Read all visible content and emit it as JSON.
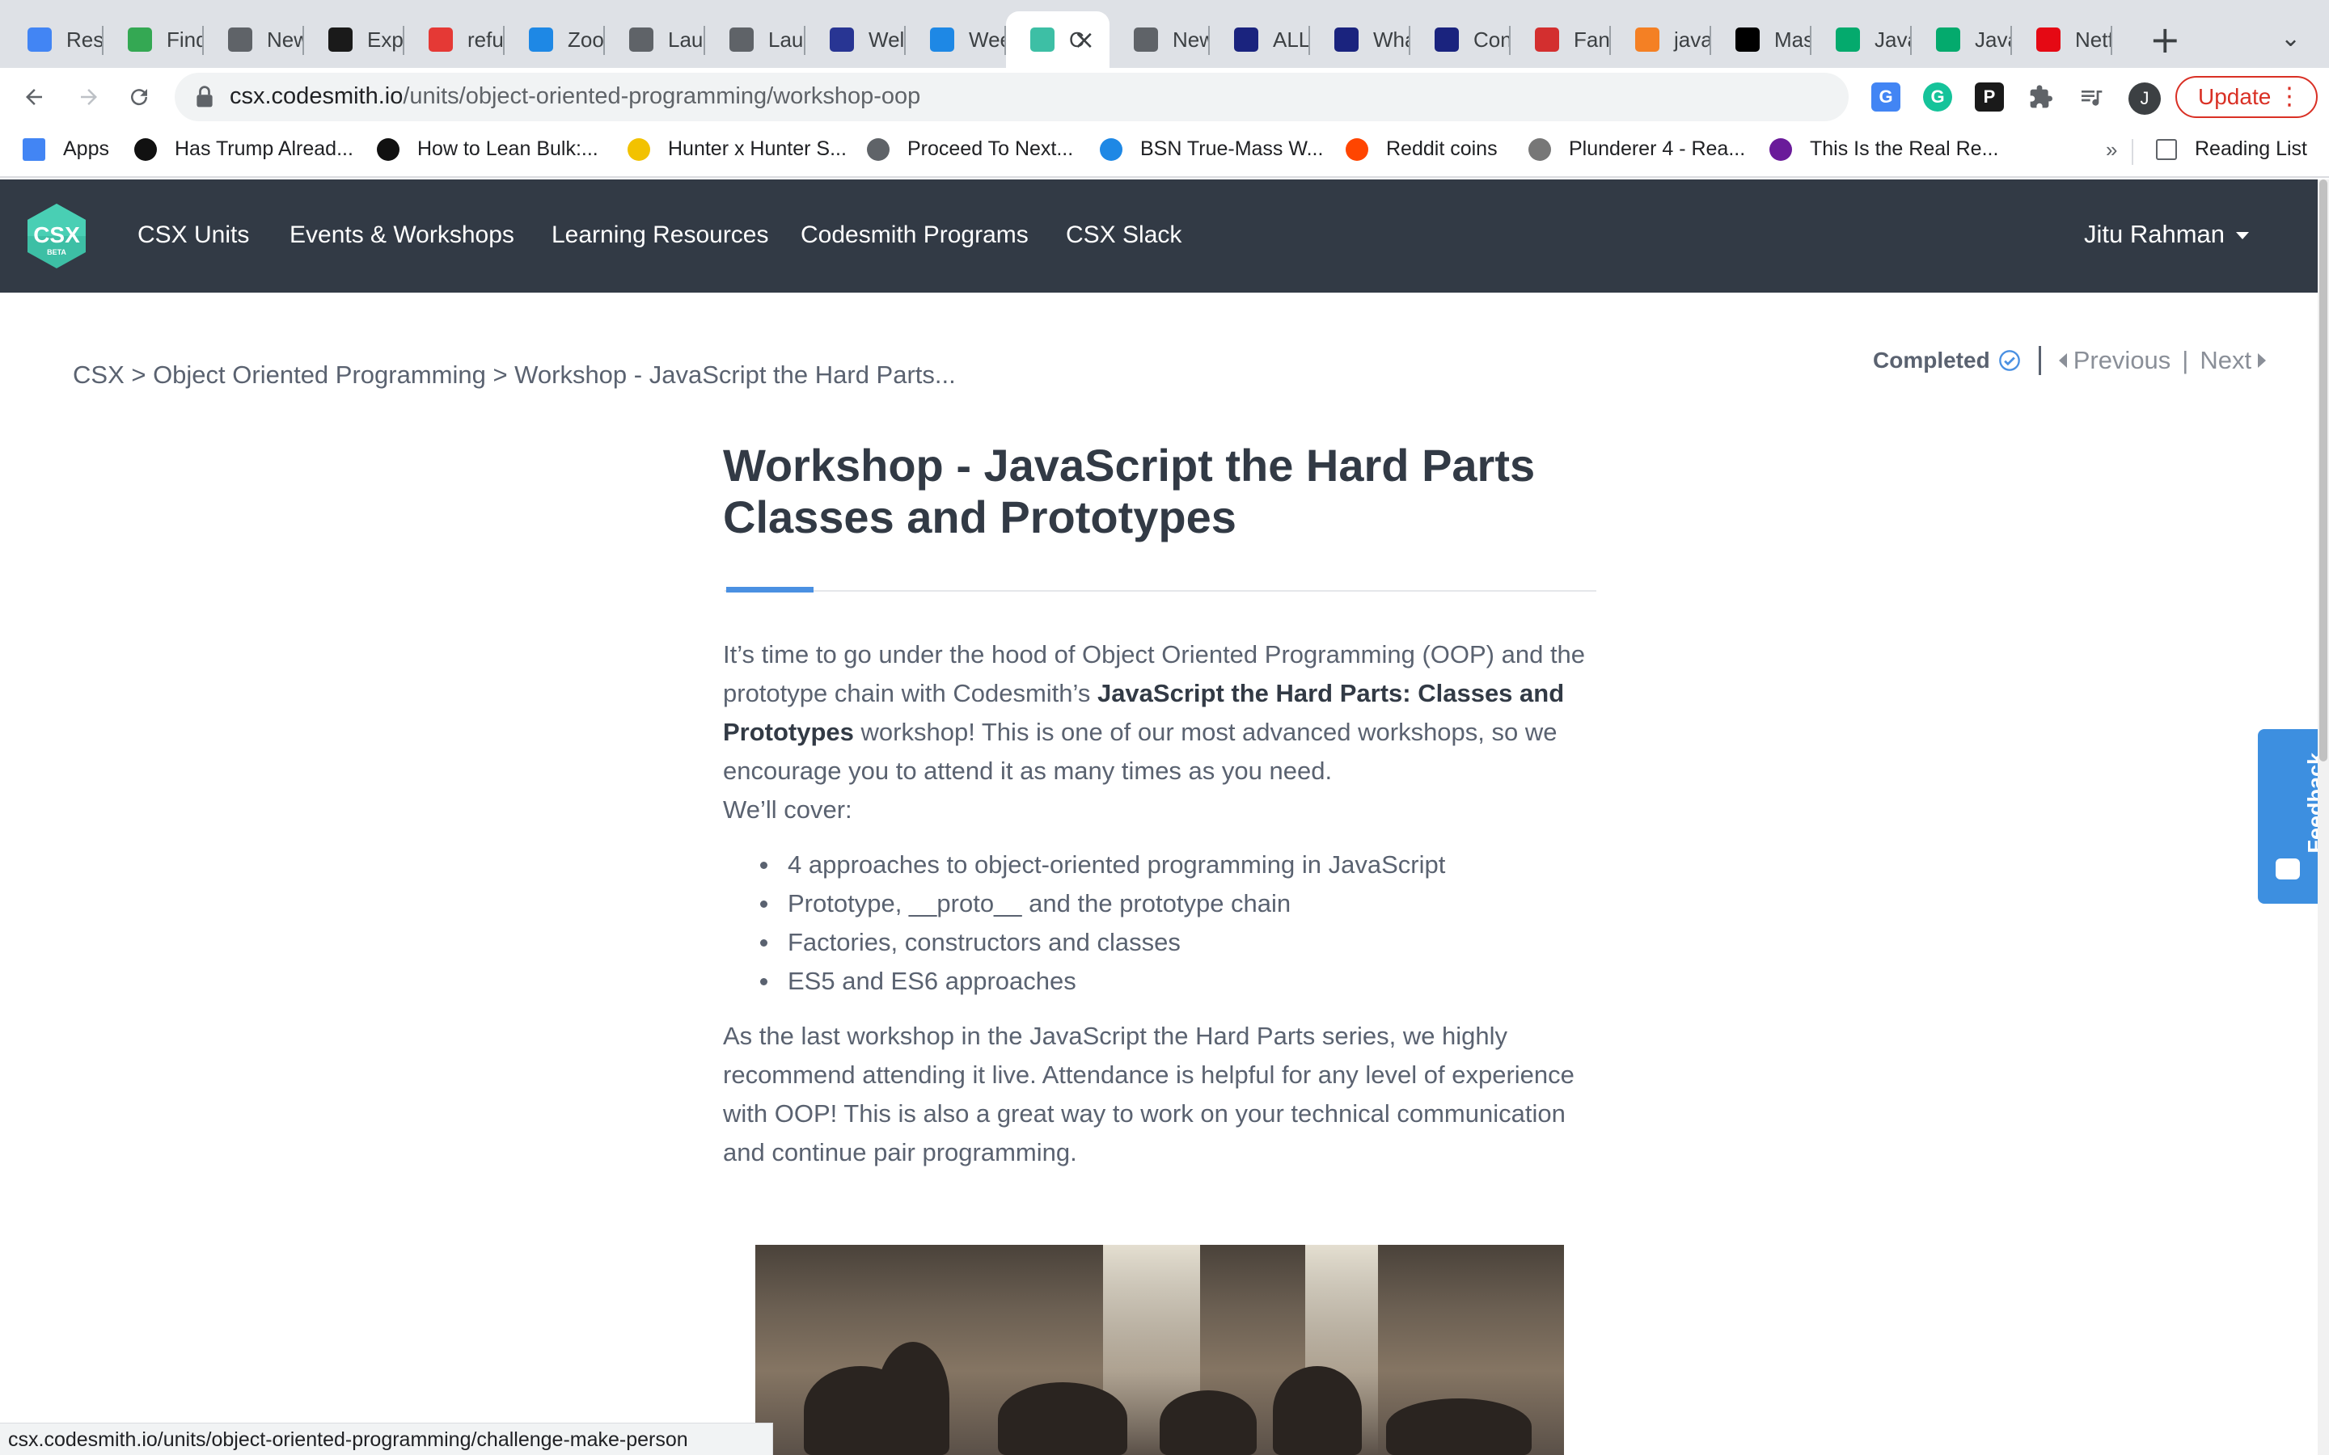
{
  "browser": {
    "tabs": [
      {
        "title": "Resu",
        "icon": "docs-icon",
        "color": "#4285f4"
      },
      {
        "title": "Find",
        "icon": "find-icon",
        "color": "#34a853"
      },
      {
        "title": "New",
        "icon": "chrome-icon",
        "color": "#5f6368"
      },
      {
        "title": "Expr",
        "icon": "express-icon",
        "color": "#1a1a1a"
      },
      {
        "title": "refu",
        "icon": "tp-icon",
        "color": "#e53935"
      },
      {
        "title": "Zoo",
        "icon": "graduation-cap-icon",
        "color": "#1e88e5"
      },
      {
        "title": "Laur",
        "icon": "globe-icon",
        "color": "#5f6368"
      },
      {
        "title": "Laur",
        "icon": "globe-icon",
        "color": "#5f6368"
      },
      {
        "title": "Wel",
        "icon": "bar-chart-icon",
        "color": "#283593"
      },
      {
        "title": "Wee",
        "icon": "graduation-cap-icon",
        "color": "#1e88e5"
      },
      {
        "title": "C",
        "icon": "csx-icon",
        "color": "#3dbfa5",
        "active": true
      },
      {
        "title": "New",
        "icon": "chrome-icon",
        "color": "#5f6368"
      },
      {
        "title": "ALL",
        "icon": "seventeen-icon",
        "color": "#1a237e"
      },
      {
        "title": "Wha",
        "icon": "seventeen-icon",
        "color": "#1a237e"
      },
      {
        "title": "Con",
        "icon": "seventeen-icon",
        "color": "#1a237e"
      },
      {
        "title": "Fan",
        "icon": "checker-icon",
        "color": "#d32f2f"
      },
      {
        "title": "java",
        "icon": "stackoverflow-icon",
        "color": "#f48024"
      },
      {
        "title": "Mas",
        "icon": "dev-icon",
        "color": "#000000"
      },
      {
        "title": "Java",
        "icon": "w3-icon",
        "color": "#04aa6d"
      },
      {
        "title": "Java",
        "icon": "w3-icon",
        "color": "#04aa6d"
      },
      {
        "title": "Netf",
        "icon": "netflix-icon",
        "color": "#e50914"
      }
    ],
    "url_host": "csx.codesmith.io",
    "url_path": "/units/object-oriented-programming/workshop-oop",
    "update_label": "Update",
    "profile_initial": "J",
    "bookmarks": [
      {
        "label": "Apps",
        "color": "#4285f4"
      },
      {
        "label": "Has Trump Alread...",
        "color": "#111111"
      },
      {
        "label": "How to Lean Bulk:...",
        "color": "#111111"
      },
      {
        "label": "Hunter x Hunter S...",
        "color": "#f2c200"
      },
      {
        "label": "Proceed To Next...",
        "color": "#5f6368"
      },
      {
        "label": "BSN True-Mass W...",
        "color": "#1e88e5"
      },
      {
        "label": "Reddit coins",
        "color": "#ff4500"
      },
      {
        "label": "Plunderer 4 - Rea...",
        "color": "#777777"
      },
      {
        "label": "This Is the Real Re...",
        "color": "#6a1b9a"
      }
    ],
    "bookmarks_more": "»",
    "reading_list": "Reading List",
    "status_url": "csx.codesmith.io/units/object-oriented-programming/challenge-make-person"
  },
  "site": {
    "logo_text": "CSX",
    "logo_badge": "BETA",
    "nav": [
      "CSX Units",
      "Events & Workshops",
      "Learning Resources",
      "Codesmith Programs",
      "CSX Slack"
    ],
    "user_name": "Jitu Rahman",
    "accent": "#4a90e2",
    "nav_bg": "#323a45"
  },
  "page": {
    "breadcrumb": "CSX > Object Oriented Programming > Workshop - JavaScript the Hard Parts...",
    "completed_label": "Completed",
    "previous_label": "Previous",
    "next_label": "Next",
    "title_line1": "Workshop - JavaScript the Hard Parts",
    "title_line2": "Classes and Prototypes",
    "intro_before": "It’s time to go under the hood of Object Oriented Programming (OOP) and the prototype chain with Codesmith’s ",
    "intro_bold": "JavaScript the Hard Parts: Classes and Prototypes",
    "intro_after": " workshop! This is one of our most advanced workshops, so we encourage you to attend it as many times as you need.",
    "cover_label": "We’ll cover:",
    "cover_items": [
      "4 approaches to object-oriented programming in JavaScript",
      "Prototype, __proto__ and the prototype chain",
      "Factories, constructors and classes",
      "ES5 and ES6 approaches"
    ],
    "closing": "As the last workshop in the JavaScript the Hard Parts series, we highly recommend attending it live. Attendance is helpful for any level of experience with OOP! This is also a great way to work on your technical communication and continue pair programming.",
    "feedback_label": "Feedback"
  }
}
